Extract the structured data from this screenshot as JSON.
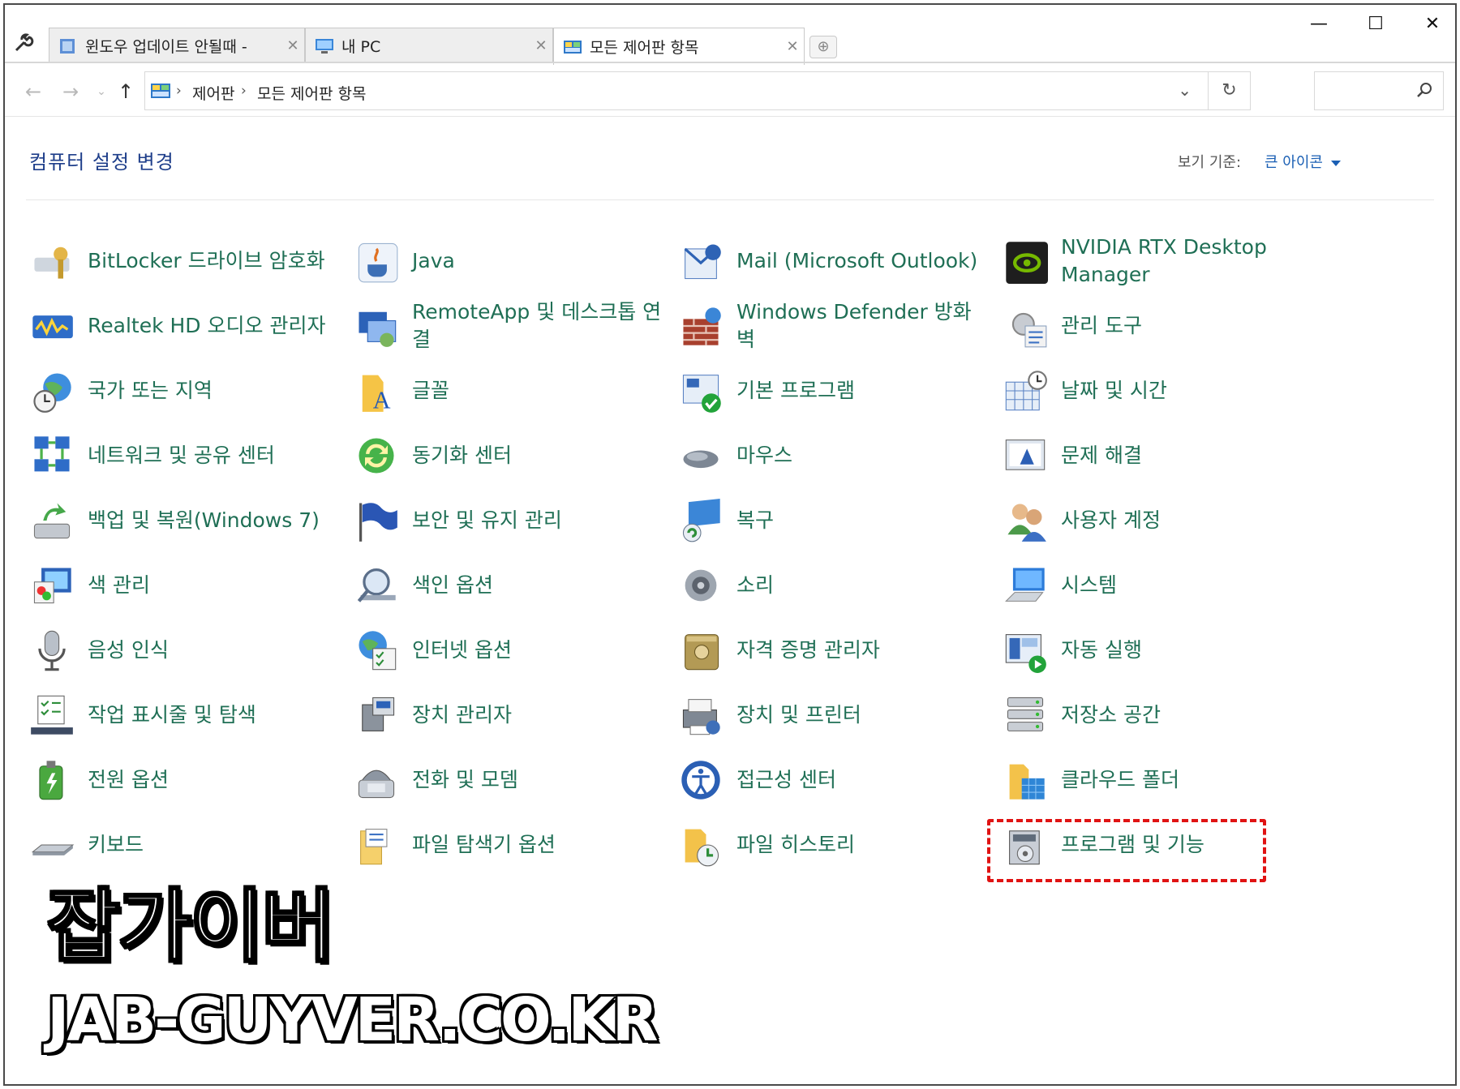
{
  "tabs": [
    {
      "label": "윈도우 업데이트 안될때 - ",
      "icon": "blog-page-icon"
    },
    {
      "label": "내 PC",
      "icon": "this-pc-icon"
    },
    {
      "label": "모든 제어판 항목",
      "icon": "control-panel-icon"
    }
  ],
  "window_buttons": {
    "minimize": "—",
    "maximize": "☐",
    "close": "✕"
  },
  "breadcrumb": [
    "제어판",
    "모든 제어판 항목"
  ],
  "search_placeholder": "",
  "header": {
    "title": "컴퓨터 설정 변경",
    "view_by_label": "보기 기준:",
    "view_by_value": "큰 아이콘"
  },
  "items": [
    {
      "label": "BitLocker 드라이브 암호화",
      "icon": "bitlocker-key-icon"
    },
    {
      "label": "Java",
      "icon": "java-cup-icon"
    },
    {
      "label": "Mail (Microsoft Outlook)",
      "icon": "mail-icon"
    },
    {
      "label": "NVIDIA RTX Desktop Manager",
      "icon": "nvidia-icon"
    },
    {
      "label": "Realtek HD 오디오 관리자",
      "icon": "realtek-audio-icon"
    },
    {
      "label": "RemoteApp 및 데스크톱 연결",
      "icon": "remoteapp-icon"
    },
    {
      "label": "Windows Defender 방화벽",
      "icon": "firewall-icon"
    },
    {
      "label": "관리 도구",
      "icon": "admin-tools-icon"
    },
    {
      "label": "국가 또는 지역",
      "icon": "globe-clock-icon"
    },
    {
      "label": "글꼴",
      "icon": "font-folder-icon"
    },
    {
      "label": "기본 프로그램",
      "icon": "default-programs-icon"
    },
    {
      "label": "날짜 및 시간",
      "icon": "calendar-clock-icon"
    },
    {
      "label": "네트워크 및 공유 센터",
      "icon": "network-icon"
    },
    {
      "label": "동기화 센터",
      "icon": "sync-icon"
    },
    {
      "label": "마우스",
      "icon": "mouse-icon"
    },
    {
      "label": "문제 해결",
      "icon": "troubleshoot-icon"
    },
    {
      "label": "백업 및 복원(Windows 7)",
      "icon": "backup-icon"
    },
    {
      "label": "보안 및 유지 관리",
      "icon": "flag-icon"
    },
    {
      "label": "복구",
      "icon": "recovery-icon"
    },
    {
      "label": "사용자 계정",
      "icon": "users-icon"
    },
    {
      "label": "색 관리",
      "icon": "color-management-icon"
    },
    {
      "label": "색인 옵션",
      "icon": "indexing-icon"
    },
    {
      "label": "소리",
      "icon": "speaker-icon"
    },
    {
      "label": "시스템",
      "icon": "system-icon"
    },
    {
      "label": "음성 인식",
      "icon": "microphone-icon"
    },
    {
      "label": "인터넷 옵션",
      "icon": "internet-options-icon"
    },
    {
      "label": "자격 증명 관리자",
      "icon": "credential-vault-icon"
    },
    {
      "label": "자동 실행",
      "icon": "autoplay-icon"
    },
    {
      "label": "작업 표시줄 및 탐색",
      "icon": "taskbar-icon"
    },
    {
      "label": "장치 관리자",
      "icon": "device-manager-icon"
    },
    {
      "label": "장치 및 프린터",
      "icon": "printer-icon"
    },
    {
      "label": "저장소 공간",
      "icon": "storage-spaces-icon"
    },
    {
      "label": "전원 옵션",
      "icon": "power-battery-icon"
    },
    {
      "label": "전화 및 모뎀",
      "icon": "phone-modem-icon"
    },
    {
      "label": "접근성 센터",
      "icon": "ease-of-access-icon"
    },
    {
      "label": "클라우드 폴더",
      "icon": "cloud-folder-icon"
    },
    {
      "label": "키보드",
      "icon": "keyboard-icon"
    },
    {
      "label": "파일 탐색기 옵션",
      "icon": "folder-options-icon"
    },
    {
      "label": "파일 히스토리",
      "icon": "file-history-icon"
    },
    {
      "label": "프로그램 및 기능",
      "icon": "programs-features-icon"
    }
  ],
  "watermark": {
    "line1": "잡가이버",
    "line2": "JAB-GUYVER.CO.KR"
  },
  "colors": {
    "link_green": "#1f6f55",
    "title_blue": "#1e3e8a",
    "highlight_red": "#e01313"
  }
}
